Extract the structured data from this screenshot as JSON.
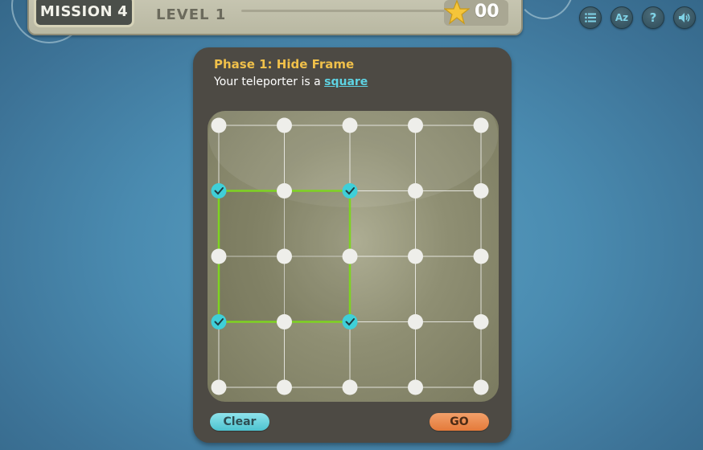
{
  "header": {
    "mission_word": "MISSION",
    "mission_number": "4",
    "level_label": "LEVEL 1",
    "score": "00",
    "score_icon": "star-icon"
  },
  "toolbar": [
    {
      "name": "menu-list-icon",
      "glyph": "≡"
    },
    {
      "name": "az-glossary-icon",
      "glyph": "Az"
    },
    {
      "name": "help-icon",
      "glyph": "?"
    },
    {
      "name": "sound-icon",
      "glyph": "🔊"
    }
  ],
  "phase": {
    "title": "Phase 1: Hide Frame",
    "subtitle_prefix": "Your teleporter is a",
    "shape_link": "square"
  },
  "grid": {
    "rows": 5,
    "cols": 5,
    "selected": [
      [
        0,
        1
      ],
      [
        2,
        1
      ],
      [
        0,
        3
      ],
      [
        2,
        3
      ]
    ],
    "frame_color": "#7ed321",
    "selected_color": "#3fcfd8",
    "node_color": "#eeeeea"
  },
  "buttons": {
    "clear": "Clear",
    "go": "GO"
  }
}
